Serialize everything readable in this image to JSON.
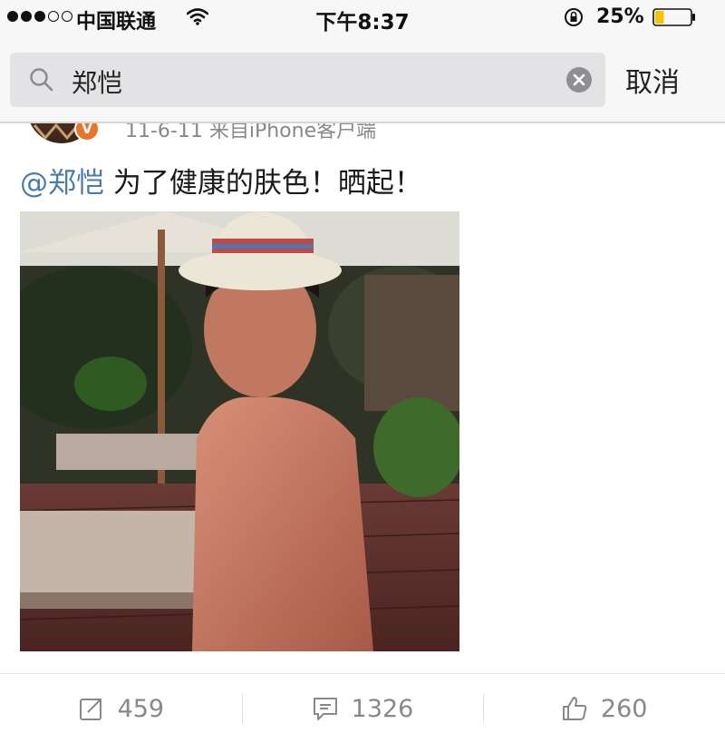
{
  "status_bar": {
    "carrier": "中国联通",
    "time": "下午8:37",
    "battery_percent": "25%",
    "battery_level": 0.25,
    "signal_bars_filled": 3,
    "signal_bars_total": 5
  },
  "search": {
    "query": "郑恺",
    "cancel_label": "取消"
  },
  "post": {
    "meta": "11-6-11  来自iPhone客户端",
    "mention": "@郑恺",
    "text": " 为了健康的肤色！晒起！"
  },
  "actions": {
    "repost_count": "459",
    "comment_count": "1326",
    "like_count": "260"
  },
  "colors": {
    "mention": "#4a7aa8",
    "vip_badge": "#e8752b",
    "battery_fill": "#f5c400"
  },
  "icons": [
    "wifi-icon",
    "lock-rotation-icon",
    "battery-icon",
    "search-icon",
    "clear-icon",
    "repost-icon",
    "comment-icon",
    "like-icon"
  ]
}
